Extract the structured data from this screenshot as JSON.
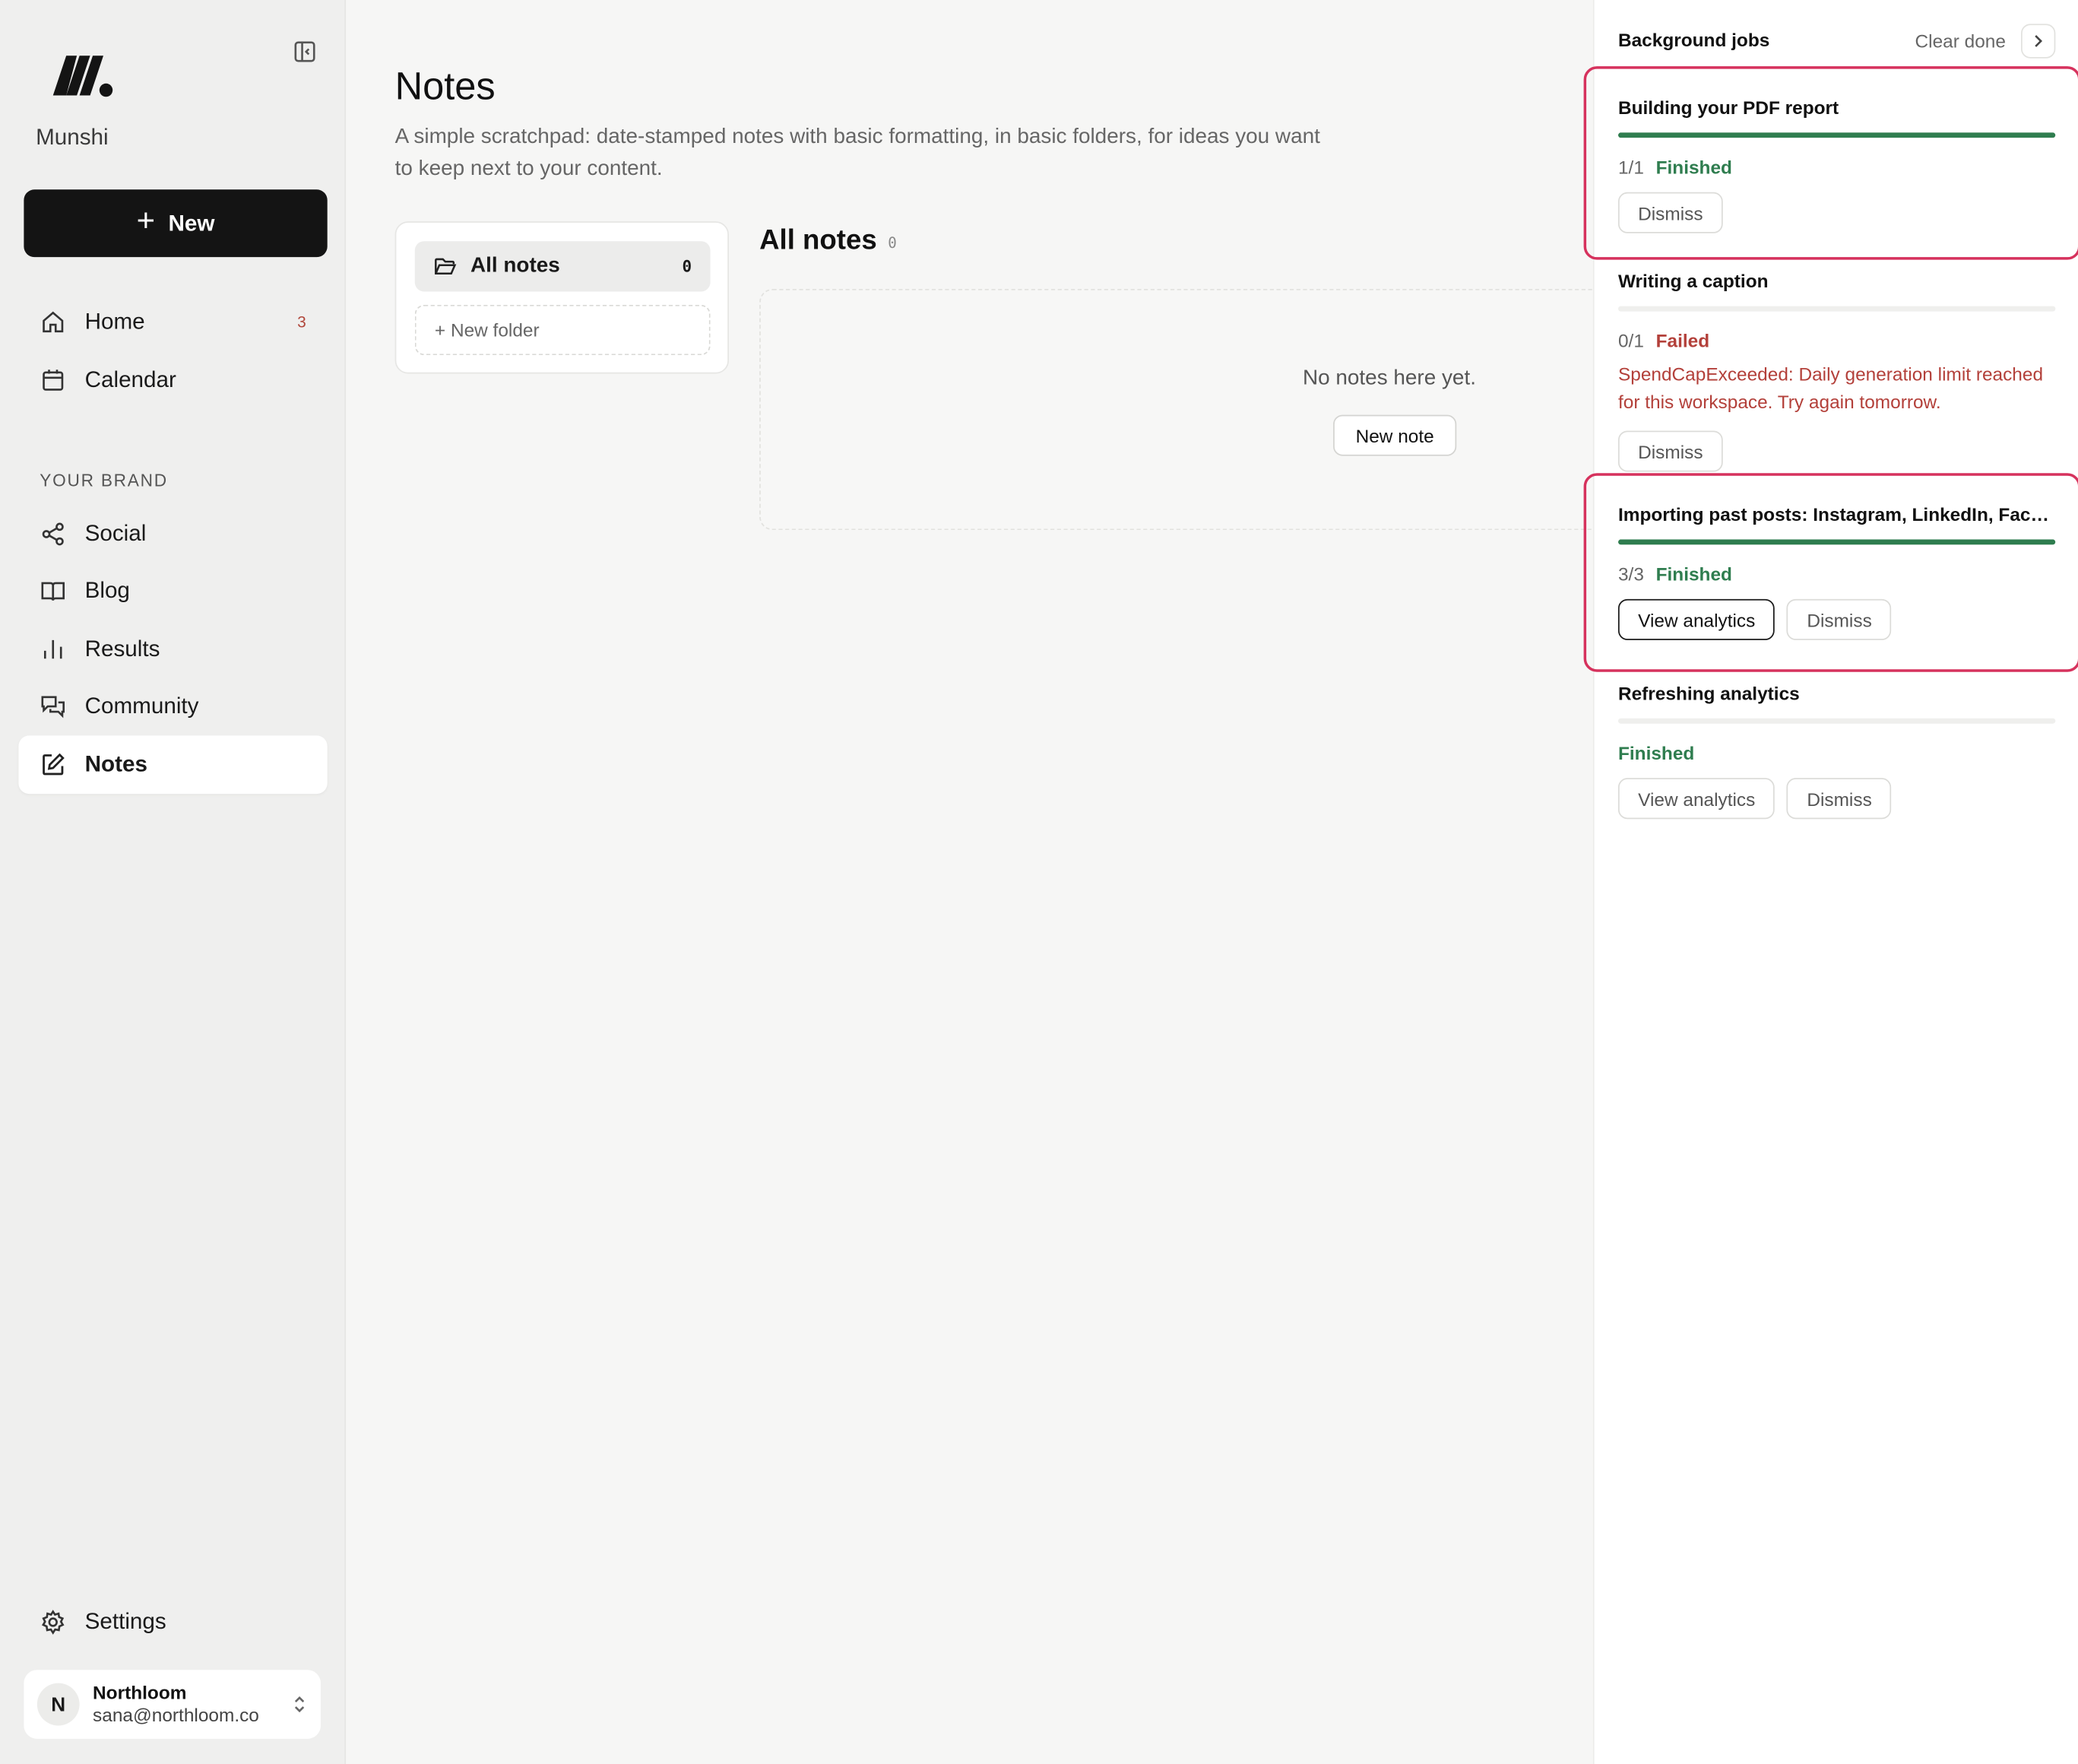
{
  "app": {
    "name": "Munshi"
  },
  "sidebar": {
    "new_label": "New",
    "items": [
      {
        "label": "Home",
        "icon": "home-icon",
        "badge": "3"
      },
      {
        "label": "Calendar",
        "icon": "calendar-icon"
      },
      {
        "label": "Social",
        "icon": "share-icon"
      },
      {
        "label": "Blog",
        "icon": "book-icon"
      },
      {
        "label": "Results",
        "icon": "bar-chart-icon"
      },
      {
        "label": "Community",
        "icon": "chat-icon"
      },
      {
        "label": "Notes",
        "icon": "edit-icon",
        "active": true
      }
    ],
    "section_label": "YOUR BRAND",
    "settings_label": "Settings",
    "account": {
      "initial": "N",
      "name": "Northloom",
      "email": "sana@northloom.co"
    }
  },
  "main": {
    "title": "Notes",
    "description": "A simple scratchpad: date-stamped notes with basic formatting, in basic folders, for ideas you want to keep next to your content.",
    "folders": {
      "all_label": "All notes",
      "all_count": "0",
      "new_folder_label": "+ New folder"
    },
    "notes_heading": "All notes",
    "notes_count": "0",
    "empty_text": "No notes here yet.",
    "new_note_label": "New note"
  },
  "jobs": {
    "title": "Background jobs",
    "clear_done_label": "Clear done",
    "items": [
      {
        "title": "Building your PDF report",
        "progress": 1.0,
        "count": "1/1",
        "status": "Finished",
        "dismiss": "Dismiss"
      },
      {
        "title": "Writing a caption",
        "progress": 0.0,
        "count": "0/1",
        "status": "Failed",
        "error": "SpendCapExceeded: Daily generation limit reached for this workspace. Try again tomorrow.",
        "dismiss": "Dismiss"
      },
      {
        "title": "Importing past posts: Instagram, LinkedIn, Face...",
        "progress": 1.0,
        "count": "3/3",
        "status": "Finished",
        "view": "View analytics",
        "dismiss": "Dismiss"
      },
      {
        "title": "Refreshing analytics",
        "progress": 0.0,
        "status": "Finished",
        "view": "View analytics",
        "dismiss": "Dismiss"
      }
    ]
  },
  "colors": {
    "accent": "#141414",
    "success": "#2f7d4f",
    "error": "#b3403a",
    "highlight": "#d6325d"
  }
}
